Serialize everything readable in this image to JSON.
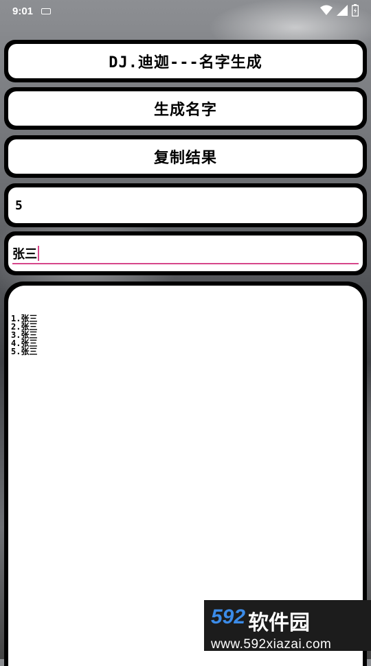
{
  "status_bar": {
    "time": "9:01"
  },
  "buttons": {
    "title": "DJ.迪迦---名字生成",
    "generate": "生成名字",
    "copy": "复制结果"
  },
  "count_field": {
    "value": "5"
  },
  "name_input": {
    "value": "张三"
  },
  "results": [
    "1.张三",
    "2.张三",
    "3.张三",
    "4.张三",
    "5.张三"
  ],
  "watermark": {
    "number": "592",
    "brand": "软件园",
    "url": "www.592xiazai.com"
  },
  "colors": {
    "accent": "#d6458a",
    "card_border": "#000000",
    "watermark_blue": "#3b8be8"
  }
}
